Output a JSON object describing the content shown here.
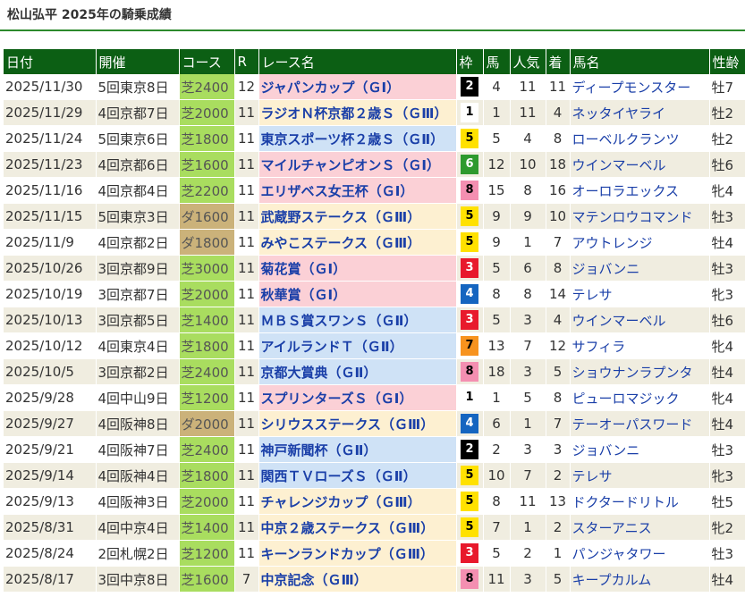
{
  "title": "松山弘平 2025年の騎乗成績",
  "accent_color": "#0c5f14",
  "headers": {
    "date": "日付",
    "venue": "開催",
    "course": "コース",
    "r": "R",
    "race": "レース名",
    "frame": "枠",
    "num": "馬",
    "pop": "人気",
    "fin": "着",
    "horse": "馬名",
    "sexage": "性齢"
  },
  "frame_colors": {
    "1": {
      "bg": "#ffffff",
      "fg": "#000000"
    },
    "2": {
      "bg": "#000000",
      "fg": "#ffffff"
    },
    "3": {
      "bg": "#e8192c",
      "fg": "#ffffff"
    },
    "4": {
      "bg": "#1565c0",
      "fg": "#ffffff"
    },
    "5": {
      "bg": "#ffe100",
      "fg": "#000000"
    },
    "6": {
      "bg": "#2e9a2e",
      "fg": "#ffffff"
    },
    "7": {
      "bg": "#f7931e",
      "fg": "#000000"
    },
    "8": {
      "bg": "#f48fb1",
      "fg": "#000000"
    }
  },
  "rows": [
    {
      "date": "2025/11/30",
      "venue": "5回東京8日",
      "course": "芝2400",
      "surface": "turf",
      "r": "12",
      "race": "ジャパンカップ（ＧⅠ）",
      "grade": "g1",
      "frame": "2",
      "num": "4",
      "pop": "11",
      "fin": "11",
      "horse": "ディープモンスター",
      "sexage": "牡7"
    },
    {
      "date": "2025/11/29",
      "venue": "4回京都7日",
      "course": "芝2000",
      "surface": "turf",
      "r": "11",
      "race": "ラジオＮ杯京都２歳Ｓ（ＧⅢ）",
      "grade": "g3",
      "frame": "1",
      "num": "1",
      "pop": "11",
      "fin": "4",
      "horse": "ネッタイヤライ",
      "sexage": "牡2"
    },
    {
      "date": "2025/11/24",
      "venue": "5回東京6日",
      "course": "芝1800",
      "surface": "turf",
      "r": "11",
      "race": "東京スポーツ杯２歳Ｓ（ＧⅡ）",
      "grade": "g2",
      "frame": "5",
      "num": "5",
      "pop": "4",
      "fin": "8",
      "horse": "ローベルクランツ",
      "sexage": "牡2"
    },
    {
      "date": "2025/11/23",
      "venue": "4回京都6日",
      "course": "芝1600",
      "surface": "turf",
      "r": "11",
      "race": "マイルチャンピオンＳ（ＧⅠ）",
      "grade": "g1",
      "frame": "6",
      "num": "12",
      "pop": "10",
      "fin": "18",
      "horse": "ウインマーベル",
      "sexage": "牡6"
    },
    {
      "date": "2025/11/16",
      "venue": "4回京都4日",
      "course": "芝2200",
      "surface": "turf",
      "r": "11",
      "race": "エリザベス女王杯（ＧⅠ）",
      "grade": "g1",
      "frame": "8",
      "num": "15",
      "pop": "8",
      "fin": "16",
      "horse": "オーロラエックス",
      "sexage": "牝4"
    },
    {
      "date": "2025/11/15",
      "venue": "5回東京3日",
      "course": "ダ1600",
      "surface": "dirt",
      "r": "11",
      "race": "武蔵野ステークス（ＧⅢ）",
      "grade": "g3",
      "frame": "5",
      "num": "9",
      "pop": "9",
      "fin": "10",
      "horse": "マテンロウコマンド",
      "sexage": "牡3"
    },
    {
      "date": "2025/11/9",
      "venue": "4回京都2日",
      "course": "ダ1800",
      "surface": "dirt",
      "r": "11",
      "race": "みやこステークス（ＧⅢ）",
      "grade": "g3",
      "frame": "5",
      "num": "9",
      "pop": "1",
      "fin": "7",
      "horse": "アウトレンジ",
      "sexage": "牡4"
    },
    {
      "date": "2025/10/26",
      "venue": "3回京都9日",
      "course": "芝3000",
      "surface": "turf",
      "r": "11",
      "race": "菊花賞（ＧⅠ）",
      "grade": "g1",
      "frame": "3",
      "num": "5",
      "pop": "6",
      "fin": "8",
      "horse": "ジョバンニ",
      "sexage": "牡3"
    },
    {
      "date": "2025/10/19",
      "venue": "3回京都7日",
      "course": "芝2000",
      "surface": "turf",
      "r": "11",
      "race": "秋華賞（ＧⅠ）",
      "grade": "g1",
      "frame": "4",
      "num": "8",
      "pop": "8",
      "fin": "14",
      "horse": "テレサ",
      "sexage": "牝3"
    },
    {
      "date": "2025/10/13",
      "venue": "3回京都5日",
      "course": "芝1400",
      "surface": "turf",
      "r": "11",
      "race": "ＭＢＳ賞スワンＳ（ＧⅡ）",
      "grade": "g2",
      "frame": "3",
      "num": "5",
      "pop": "3",
      "fin": "4",
      "horse": "ウインマーベル",
      "sexage": "牡6"
    },
    {
      "date": "2025/10/12",
      "venue": "4回東京4日",
      "course": "芝1800",
      "surface": "turf",
      "r": "11",
      "race": "アイルランドＴ（ＧⅡ）",
      "grade": "g2",
      "frame": "7",
      "num": "13",
      "pop": "7",
      "fin": "12",
      "horse": "サフィラ",
      "sexage": "牝4"
    },
    {
      "date": "2025/10/5",
      "venue": "3回京都2日",
      "course": "芝2400",
      "surface": "turf",
      "r": "11",
      "race": "京都大賞典（ＧⅡ）",
      "grade": "g2",
      "frame": "8",
      "num": "18",
      "pop": "3",
      "fin": "5",
      "horse": "ショウナンラプンタ",
      "sexage": "牡4"
    },
    {
      "date": "2025/9/28",
      "venue": "4回中山9日",
      "course": "芝1200",
      "surface": "turf",
      "r": "11",
      "race": "スプリンターズＳ（ＧⅠ）",
      "grade": "g1",
      "frame": "1",
      "num": "1",
      "pop": "5",
      "fin": "8",
      "horse": "ピューロマジック",
      "sexage": "牝4"
    },
    {
      "date": "2025/9/27",
      "venue": "4回阪神8日",
      "course": "ダ2000",
      "surface": "dirt",
      "r": "11",
      "race": "シリウスステークス（ＧⅢ）",
      "grade": "g3",
      "frame": "4",
      "num": "6",
      "pop": "1",
      "fin": "7",
      "horse": "テーオーパスワード",
      "sexage": "牡4"
    },
    {
      "date": "2025/9/21",
      "venue": "4回阪神7日",
      "course": "芝2400",
      "surface": "turf",
      "r": "11",
      "race": "神戸新聞杯（ＧⅡ）",
      "grade": "g2",
      "frame": "2",
      "num": "2",
      "pop": "3",
      "fin": "3",
      "horse": "ジョバンニ",
      "sexage": "牡3"
    },
    {
      "date": "2025/9/14",
      "venue": "4回阪神4日",
      "course": "芝1800",
      "surface": "turf",
      "r": "11",
      "race": "関西ＴＶローズＳ（ＧⅡ）",
      "grade": "g2",
      "frame": "5",
      "num": "10",
      "pop": "7",
      "fin": "2",
      "horse": "テレサ",
      "sexage": "牝3"
    },
    {
      "date": "2025/9/13",
      "venue": "4回阪神3日",
      "course": "芝2000",
      "surface": "turf",
      "r": "11",
      "race": "チャレンジカップ（ＧⅢ）",
      "grade": "g3",
      "frame": "5",
      "num": "8",
      "pop": "11",
      "fin": "13",
      "horse": "ドクタードリトル",
      "sexage": "牡5"
    },
    {
      "date": "2025/8/31",
      "venue": "4回中京4日",
      "course": "芝1400",
      "surface": "turf",
      "r": "11",
      "race": "中京２歳ステークス（ＧⅢ）",
      "grade": "g3",
      "frame": "5",
      "num": "7",
      "pop": "1",
      "fin": "2",
      "horse": "スターアニス",
      "sexage": "牝2"
    },
    {
      "date": "2025/8/24",
      "venue": "2回札幌2日",
      "course": "芝1200",
      "surface": "turf",
      "r": "11",
      "race": "キーンランドカップ（ＧⅢ）",
      "grade": "g3",
      "frame": "3",
      "num": "5",
      "pop": "2",
      "fin": "1",
      "horse": "パンジャタワー",
      "sexage": "牡3"
    },
    {
      "date": "2025/8/17",
      "venue": "3回中京8日",
      "course": "芝1600",
      "surface": "turf",
      "r": "7",
      "race": "中京記念（ＧⅢ）",
      "grade": "g3",
      "frame": "8",
      "num": "11",
      "pop": "3",
      "fin": "5",
      "horse": "キープカルム",
      "sexage": "牡4"
    }
  ]
}
